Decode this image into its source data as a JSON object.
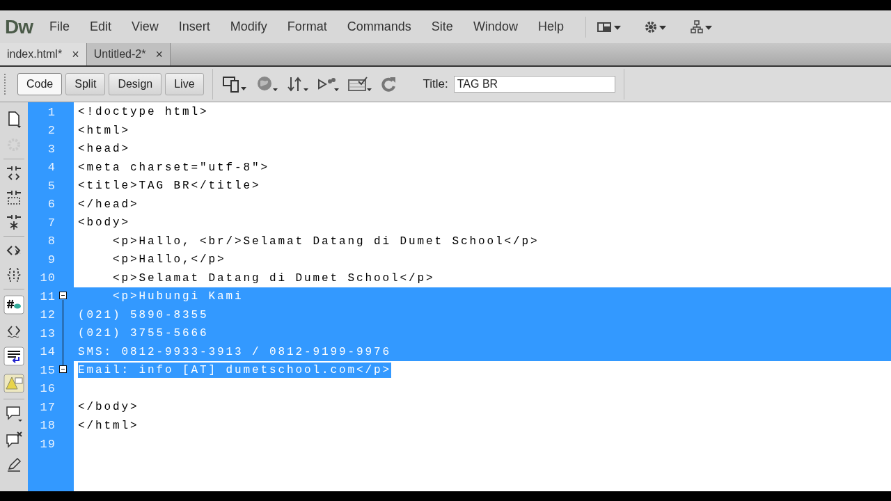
{
  "app": {
    "logo": "Dw"
  },
  "menu": [
    "File",
    "Edit",
    "View",
    "Insert",
    "Modify",
    "Format",
    "Commands",
    "Site",
    "Window",
    "Help"
  ],
  "tabs": [
    {
      "label": "index.html*",
      "selected": true,
      "close": "×"
    },
    {
      "label": "Untitled-2*",
      "selected": false,
      "close": "×"
    }
  ],
  "view_buttons": [
    {
      "label": "Code",
      "selected": true
    },
    {
      "label": "Split",
      "selected": false
    },
    {
      "label": "Design",
      "selected": false
    },
    {
      "label": "Live",
      "selected": false
    }
  ],
  "title_field": {
    "label": "Title:",
    "value": "TAG BR"
  },
  "code_lines": [
    {
      "number": "1",
      "text": "<!doctype html>",
      "selected": false
    },
    {
      "number": "2",
      "text": "<html>",
      "selected": false
    },
    {
      "number": "3",
      "text": "<head>",
      "selected": false
    },
    {
      "number": "4",
      "text": "<meta charset=\"utf-8\">",
      "selected": false
    },
    {
      "number": "5",
      "text": "<title>TAG BR</title>",
      "selected": false
    },
    {
      "number": "6",
      "text": "</head>",
      "selected": false
    },
    {
      "number": "7",
      "text": "<body>",
      "selected": false
    },
    {
      "number": "8",
      "text": "    <p>Hallo, <br/>Selamat Datang di Dumet School</p>",
      "selected": false
    },
    {
      "number": "9",
      "text": "    <p>Hallo,</p>",
      "selected": false
    },
    {
      "number": "10",
      "text": "    <p>Selamat Datang di Dumet School</p>",
      "selected": false
    },
    {
      "number": "11",
      "text": "    <p>Hubungi Kami",
      "selected": true,
      "fold_start": true
    },
    {
      "number": "12",
      "text": "(021) 5890-8355",
      "selected": true
    },
    {
      "number": "13",
      "text": "(021) 3755-5666",
      "selected": true
    },
    {
      "number": "14",
      "text": "SMS: 0812-9933-3913 / 0812-9199-9976",
      "selected": true
    },
    {
      "number": "15",
      "text": "Email: info [AT] dumetschool.com</p>",
      "selected": true,
      "fold_end": true
    },
    {
      "number": "16",
      "selected": false
    },
    {
      "number": "17",
      "text": "</body>",
      "selected": false
    },
    {
      "number": "18",
      "text": "</html>",
      "selected": false
    },
    {
      "number": "19",
      "selected": false
    }
  ]
}
